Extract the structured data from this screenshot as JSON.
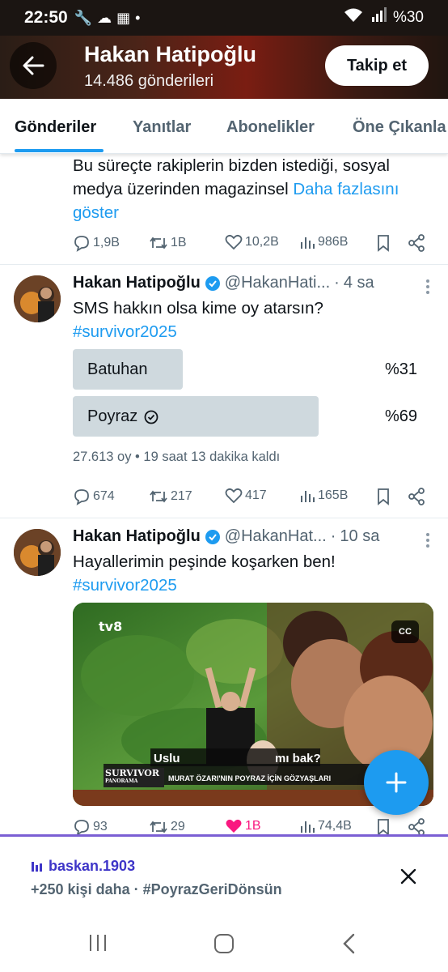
{
  "status_bar": {
    "time": "22:50",
    "battery": "%30"
  },
  "header": {
    "name": "Hakan Hatipoğlu",
    "posts": "14.486 gönderileri",
    "follow_label": "Takip et"
  },
  "tabs": [
    {
      "label": "Gönderiler",
      "active": true
    },
    {
      "label": "Yanıtlar"
    },
    {
      "label": "Abonelikler"
    },
    {
      "label": "Öne Çıkanla"
    }
  ],
  "tweet1": {
    "line1": "Bu süreçte rakiplerin bizden istediği, sosyal",
    "line2_text": "medya üzerinden magazinsel ",
    "line2_link": "Daha fazlasını",
    "line3_link": "göster",
    "replies": "1,9B",
    "retweets": "1B",
    "likes": "10,2B",
    "views": "986B"
  },
  "tweet2": {
    "author": "Hakan Hatipoğlu",
    "handle": "@HakanHati...",
    "dot": "·",
    "time": "4 sa",
    "text": "SMS hakkın olsa kime oy atarsın?",
    "hashtag": "#survivor2025",
    "poll": [
      {
        "label": "Batuhan",
        "percent": "%31",
        "value": 31,
        "selected": false
      },
      {
        "label": "Poyraz",
        "percent": "%69",
        "value": 69,
        "selected": true
      }
    ],
    "poll_meta": "27.613 oy • 19 saat 13 dakika kaldı",
    "replies": "674",
    "retweets": "217",
    "likes": "417",
    "views": "165B"
  },
  "tweet3": {
    "author": "Hakan Hatipoğlu",
    "handle": "@HakanHat...",
    "dot": "·",
    "time": "10 sa",
    "text": "Hayallerimin peşinde koşarken ben!",
    "hashtag": "#survivor2025",
    "media_caption_partial": "Uslu ... mı bak?",
    "media_caption_left": "Uslu",
    "media_caption_right": "mı bak?",
    "media_banner": "MURAT ÖZARI'NIN POYRAZ İÇİN GÖZYAŞLARI",
    "media_logo": "SURVIVOR",
    "media_logo_sub": "PANORAMA",
    "media_channel": "tv8",
    "cc_label": "CC",
    "replies": "93",
    "retweets": "29",
    "likes": "1B",
    "views": "74,4B",
    "like_color": "#f91880"
  },
  "banner": {
    "user": "baskan.1903",
    "message": "+250 kişi daha · #PoyrazGeriDönsün"
  },
  "colors": {
    "accent": "#1d9bf0",
    "banner_user": "#3e35c8"
  }
}
